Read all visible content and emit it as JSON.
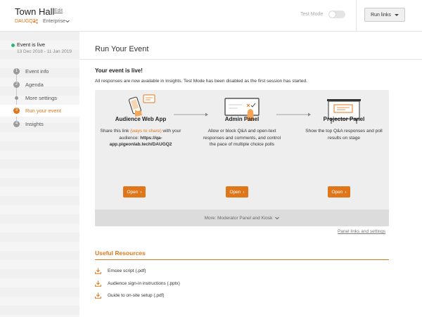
{
  "header": {
    "title": "Town Hall",
    "edit_label": "Edit",
    "event_code": "DAUGQ2",
    "plan": "Enterprise",
    "test_mode_label": "Test Mode",
    "test_mode_on": false,
    "run_links_label": "Run links"
  },
  "sidebar": {
    "status": "Event is live",
    "dates": "13 Dec 2018 - 11 Jan 2019",
    "steps": [
      {
        "num": "1",
        "label": "Event info",
        "active": false
      },
      {
        "num": "2",
        "label": "Agenda",
        "active": false
      },
      {
        "num": "",
        "label": "More settings",
        "active": false
      },
      {
        "num": "3",
        "label": "Run your event",
        "active": true
      },
      {
        "num": "4",
        "label": "Insights",
        "active": false
      }
    ]
  },
  "main": {
    "page_title": "Run Your Event",
    "live_heading": "Your event is live!",
    "live_description": "All responses are now available in Insights. Test Mode has been disabled as the first session has started.",
    "panels": [
      {
        "title": "Audience Web App",
        "desc_pre": "Share this link ",
        "desc_link": "(ways to share)",
        "desc_mid": " with your audience: ",
        "desc_bold": "https://qa-app.pigeonlab.tech/DAUGQ2",
        "open_label": "Open",
        "icon": "phone-icon"
      },
      {
        "title": "Admin Panel",
        "desc": "Allow or block Q&A and open-text responses and comments, and control the pace of multiple choice polls",
        "open_label": "Open",
        "icon": "tablet-icon"
      },
      {
        "title": "Projector Panel",
        "desc": "Show the top Q&A responses and poll results on stage",
        "open_label": "Open",
        "icon": "projector-icon"
      }
    ],
    "more_label": "More: Moderator Panel and Kiosk",
    "panel_links_label": "Panel links and settings",
    "useful_title": "Useful Resources",
    "resources": [
      {
        "label": "Emcee script (.pdf)"
      },
      {
        "label": "Audience sign-in instructions (.pptx)"
      },
      {
        "label": "Guide to on-site setup (.pdf)"
      }
    ]
  },
  "colors": {
    "accent": "#e0761a",
    "live": "#2bb673"
  }
}
